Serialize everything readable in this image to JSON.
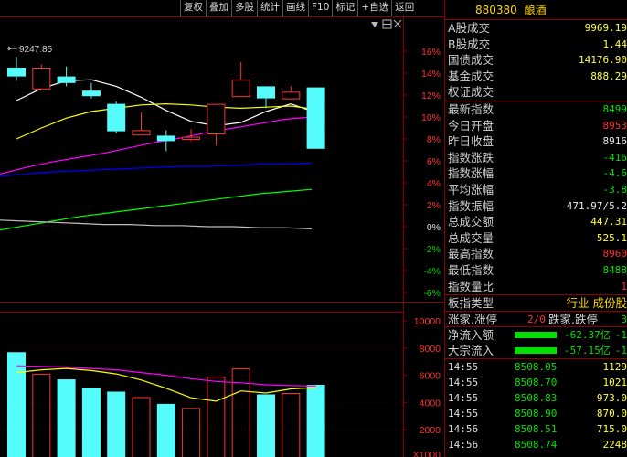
{
  "toolbar": {
    "buttons": [
      "复权",
      "叠加",
      "多股",
      "统计",
      "画线",
      "F10",
      "标记",
      "+自选",
      "返回"
    ]
  },
  "chart": {
    "peak_label": "9247.85",
    "price_axis": [
      "16%",
      "14%",
      "12%",
      "10%",
      "8%",
      "6%",
      "4%",
      "2%",
      "0%",
      "-2%",
      "-4%",
      "-6%"
    ],
    "volume_axis": [
      "10000",
      "8000",
      "6000",
      "4000",
      "2000",
      "X1000"
    ],
    "colors": {
      "up": "#ff3232",
      "down": "#54fcfc",
      "ma5": "#ffffff",
      "ma10": "#ffff00",
      "ma20": "#ff00ff",
      "ma60": "#0000ff",
      "ma120": "#00ff00",
      "ma250": "#c0c0c0"
    }
  },
  "chart_data": {
    "type": "candlestick",
    "candles": [
      {
        "dir": "down",
        "open": 14.5,
        "close": 13.7,
        "high": 15.5,
        "low": 13.3,
        "volume": 7700
      },
      {
        "dir": "up",
        "open": 12.6,
        "close": 14.5,
        "high": 14.8,
        "low": 12.4,
        "volume": 6100
      },
      {
        "dir": "down",
        "open": 13.7,
        "close": 13.1,
        "high": 14.6,
        "low": 12.8,
        "volume": 5700
      },
      {
        "dir": "down",
        "open": 12.4,
        "close": 11.9,
        "high": 13.1,
        "low": 11.7,
        "volume": 5100
      },
      {
        "dir": "down",
        "open": 11.2,
        "close": 8.7,
        "high": 11.4,
        "low": 8.5,
        "volume": 4800
      },
      {
        "dir": "up",
        "open": 8.4,
        "close": 8.8,
        "high": 10.4,
        "low": 8.4,
        "volume": 4400
      },
      {
        "dir": "down",
        "open": 8.3,
        "close": 7.8,
        "high": 8.8,
        "low": 6.9,
        "volume": 3900
      },
      {
        "dir": "up",
        "open": 8.0,
        "close": 8.2,
        "high": 8.9,
        "low": 7.8,
        "volume": 3600
      },
      {
        "dir": "up",
        "open": 8.5,
        "close": 11.2,
        "high": 11.2,
        "low": 7.4,
        "volume": 5900
      },
      {
        "dir": "up",
        "open": 11.9,
        "close": 13.4,
        "high": 15.0,
        "low": 11.9,
        "volume": 6500
      },
      {
        "dir": "down",
        "open": 12.8,
        "close": 11.7,
        "high": 12.8,
        "low": 10.8,
        "volume": 4600
      },
      {
        "dir": "up",
        "open": 11.7,
        "close": 12.3,
        "high": 12.8,
        "low": 11.6,
        "volume": 4700
      },
      {
        "dir": "down",
        "open": 12.7,
        "close": 7.1,
        "high": 12.7,
        "low": 7.1,
        "volume": 5300
      }
    ],
    "ma_lines": [
      {
        "name": "MA5",
        "values": [
          11.5,
          12.6,
          13.3,
          13.4,
          12.8,
          11.8,
          10.6,
          9.6,
          9.2,
          9.5,
          10.5,
          11.2,
          10.4
        ]
      },
      {
        "name": "MA10",
        "values": [
          8.0,
          9.0,
          9.9,
          10.5,
          10.8,
          11.1,
          11.2,
          11.1,
          10.9,
          10.8,
          10.9,
          11.0,
          10.7
        ]
      },
      {
        "name": "MA20",
        "values": [
          4.8,
          5.4,
          5.9,
          6.3,
          6.7,
          7.2,
          7.7,
          8.1,
          8.6,
          9.0,
          9.4,
          9.8,
          10.0
        ]
      },
      {
        "name": "MA60",
        "values": [
          4.6,
          4.8,
          5.0,
          5.1,
          5.2,
          5.3,
          5.4,
          5.5,
          5.5,
          5.6,
          5.7,
          5.7,
          5.8
        ]
      },
      {
        "name": "MA120",
        "values": [
          -0.3,
          0.1,
          0.5,
          0.9,
          1.2,
          1.5,
          1.8,
          2.1,
          2.4,
          2.7,
          3.0,
          3.2,
          3.4
        ]
      },
      {
        "name": "MA250",
        "values": [
          0.6,
          0.5,
          0.4,
          0.3,
          0.2,
          0.2,
          0.1,
          0.1,
          0.0,
          0.0,
          -0.1,
          -0.1,
          -0.2
        ]
      }
    ],
    "vol_ma": [
      {
        "name": "VMA5",
        "color": "#ffff00",
        "values": [
          6200,
          6400,
          6500,
          6350,
          6100,
          5650,
          5050,
          4350,
          4100,
          4850,
          4700,
          5000,
          5100
        ]
      },
      {
        "name": "VMA10",
        "color": "#ff00ff",
        "values": [
          6700,
          6650,
          6600,
          6500,
          6400,
          6200,
          6000,
          5750,
          5550,
          5450,
          5300,
          5250,
          5200
        ]
      }
    ],
    "price_ylim": [
      -6,
      16
    ],
    "volume_ylim": [
      0,
      10000
    ]
  },
  "panel": {
    "code": "880380",
    "name": "酿酒",
    "rows_a": [
      {
        "label": "A股成交",
        "value": "9969.19",
        "color": "c-yellow"
      },
      {
        "label": "B股成交",
        "value": "1.44",
        "color": "c-yellow"
      },
      {
        "label": "国债成交",
        "value": "14176.90",
        "color": "c-yellow"
      },
      {
        "label": "基金成交",
        "value": "888.29",
        "color": "c-yellow"
      },
      {
        "label": "权证成交",
        "value": "",
        "color": "c-yellow"
      }
    ],
    "rows_b": [
      {
        "label": "最新指数",
        "value": "8499",
        "color": "c-green"
      },
      {
        "label": "今日开盘",
        "value": "8953",
        "color": "c-red"
      },
      {
        "label": "昨日收盘",
        "value": "8916",
        "color": "c-white"
      },
      {
        "label": "指数涨跌",
        "value": "-416",
        "color": "c-green"
      },
      {
        "label": "指数涨幅",
        "value": "-4.6",
        "color": "c-green"
      },
      {
        "label": "平均涨幅",
        "value": "-3.8",
        "color": "c-green"
      },
      {
        "label": "指数振幅",
        "value": "471.97/5.2",
        "color": "c-white"
      },
      {
        "label": "总成交额",
        "value": "447.31",
        "color": "c-yellow"
      },
      {
        "label": "总成交量",
        "value": "525.1",
        "color": "c-yellow"
      },
      {
        "label": "最高指数",
        "value": "8960",
        "color": "c-red"
      },
      {
        "label": "最低指数",
        "value": "8488",
        "color": "c-green"
      },
      {
        "label": "指数量比",
        "value": "1",
        "color": "c-red"
      }
    ],
    "sector": {
      "label": "板指类型",
      "value": "行业 成份股"
    },
    "updown": {
      "label_up": "涨家.涨停",
      "up_val": "2/0",
      "label_down": "跌家.跌停",
      "down_val": "3"
    },
    "flows": [
      {
        "label": "净流入额",
        "value": "-62.37亿",
        "extra": "-1"
      },
      {
        "label": "大宗流入",
        "value": "-57.15亿",
        "extra": "-1"
      }
    ],
    "ticks": [
      {
        "time": "14:55",
        "price": "8508.05",
        "vol": "1129"
      },
      {
        "time": "14:55",
        "price": "8508.70",
        "vol": "1021"
      },
      {
        "time": "14:55",
        "price": "8508.83",
        "vol": "973.0"
      },
      {
        "time": "14:55",
        "price": "8508.90",
        "vol": "870.0"
      },
      {
        "time": "14:56",
        "price": "8508.51",
        "vol": "715.0"
      },
      {
        "time": "14:56",
        "price": "8508.74",
        "vol": "2248"
      }
    ]
  }
}
